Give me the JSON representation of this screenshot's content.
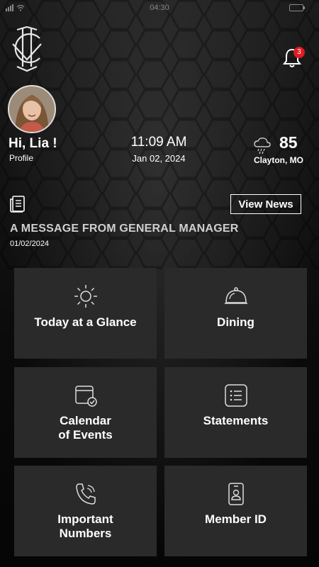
{
  "status_bar": {
    "time": "04:30"
  },
  "header": {
    "notification_count": "3"
  },
  "user": {
    "greeting": "Hi, Lia !",
    "profile_label": "Profile"
  },
  "clock": {
    "time": "11:09 AM",
    "date": "Jan 02, 2024"
  },
  "weather": {
    "temperature": "85",
    "location": "Clayton, MO",
    "icon": "rain-cloud-icon"
  },
  "news": {
    "button_label": "View News",
    "message_title": "A MESSAGE FROM GENERAL MANAGER",
    "message_date": "01/02/2024"
  },
  "tiles": [
    {
      "label": "Today at a Glance",
      "icon": "sun-icon"
    },
    {
      "label": "Dining",
      "icon": "cloche-icon"
    },
    {
      "label": "Calendar\nof Events",
      "icon": "calendar-check-icon"
    },
    {
      "label": "Statements",
      "icon": "statement-list-icon"
    },
    {
      "label": "Important\nNumbers",
      "icon": "phone-icon"
    },
    {
      "label": "Member ID",
      "icon": "id-badge-icon"
    }
  ]
}
